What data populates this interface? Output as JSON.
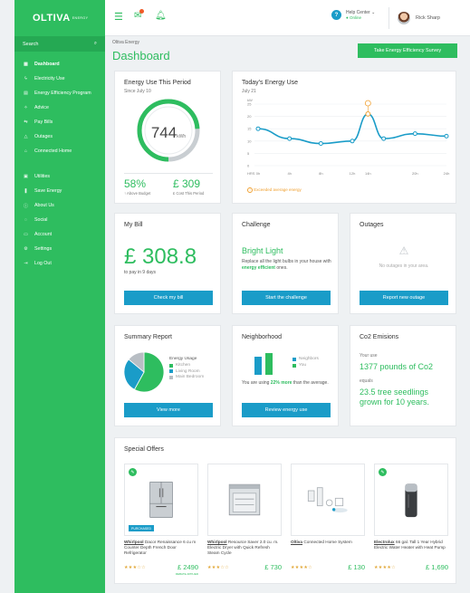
{
  "app": {
    "logo": "OLTIVA",
    "logo_sub": "ENERGY"
  },
  "sidebar": {
    "search_label": "Search",
    "items": [
      {
        "label": "Dashboard",
        "icon": "▦",
        "active": true
      },
      {
        "label": "Electricity Use",
        "icon": "ϟ"
      },
      {
        "label": "Energy Efficiency Program",
        "icon": "▤"
      },
      {
        "label": "Advice",
        "icon": "✧"
      },
      {
        "label": "Pay Bills",
        "icon": "⇆"
      },
      {
        "label": "Outages",
        "icon": "△"
      },
      {
        "label": "Connected Home",
        "icon": "⌂"
      }
    ],
    "items2": [
      {
        "label": "Utilities",
        "icon": "▣"
      },
      {
        "label": "Save Energy",
        "icon": "❚"
      },
      {
        "label": "About Us",
        "icon": "ⓘ"
      },
      {
        "label": "Social",
        "icon": "◌"
      },
      {
        "label": "Account",
        "icon": "▭"
      },
      {
        "label": "Settings",
        "icon": "⚙"
      },
      {
        "label": "Log Out",
        "icon": "⇥"
      }
    ]
  },
  "topbar": {
    "help": "Help Center",
    "status": "● Online",
    "user": "Rick Sharp"
  },
  "page": {
    "breadcrumb": "Oltiva Energy",
    "title": "Dashboard",
    "survey_button": "Take Energy Efficiency Survey"
  },
  "energy_use": {
    "title": "Energy Use This Period",
    "since": "Since July 10",
    "value": "744",
    "unit": "kWh",
    "ring_fraction": 0.74,
    "percent": "58%",
    "percent_label": "↑ Above Budget",
    "cost": "£ 309",
    "cost_label": "£ Cost This Period"
  },
  "today": {
    "title": "Today's Energy Use",
    "date": "July 21",
    "legend": "Exceeded average energy"
  },
  "chart_data": {
    "type": "line",
    "ylabel": "kW",
    "yticks": [
      "25",
      "20",
      "15",
      "10",
      "5",
      "0"
    ],
    "ylim": [
      0,
      25
    ],
    "xticks": [
      "HRS",
      "0h",
      "4h",
      "8h",
      "12h",
      "14h",
      "20h",
      "24h"
    ],
    "x": [
      0,
      4,
      8,
      12,
      14,
      16,
      20,
      24
    ],
    "values": [
      15,
      11,
      9,
      10,
      21,
      11,
      13,
      12
    ],
    "peak_index": 4,
    "color": "#1a9cc8",
    "peak_color": "#f0a030"
  },
  "bill": {
    "title": "My Bill",
    "amount": "£ 308.8",
    "due": "to pay in 9 days",
    "button": "Check my bill"
  },
  "challenge": {
    "title": "Challenge",
    "heading": "Bright Light",
    "text_pre": "Replace all the light bulbs in your house with ",
    "text_em": "energy efficient",
    "text_post": " ones.",
    "button": "Start the challenge"
  },
  "outages": {
    "title": "Outages",
    "message": "No outages in your area.",
    "button": "Report new outage"
  },
  "summary": {
    "title": "Summary Report",
    "legend_title": "Energy Usage",
    "items": [
      {
        "label": "Kitchen",
        "color": "#2ebd5f",
        "value": 0.58
      },
      {
        "label": "Living Room",
        "color": "#1a9cc8",
        "value": 0.28
      },
      {
        "label": "Main Bedroom",
        "color": "#b8bec4",
        "value": 0.14
      }
    ],
    "button": "View more"
  },
  "neighborhood": {
    "title": "Neighborhood",
    "legend": [
      "Neighbors",
      "You"
    ],
    "colors": [
      "#1a9cc8",
      "#2ebd5f"
    ],
    "neighbors_value": 0.82,
    "you_value": 1,
    "text_pre": "You are using ",
    "text_em": "22% more",
    "text_post": " than the average.",
    "button": "Review energy use"
  },
  "co2": {
    "title": "Co2 Emisions",
    "use_label": "Your use",
    "use_value": "1377 pounds of Co2",
    "equals": "equals",
    "equals_value": "23.5 tree seedlings grown for 10 years."
  },
  "offers": {
    "title": "Special Offers",
    "items": [
      {
        "brand": "Whirlpool",
        "name": " Dacor Renaissance 6 cu m Counter Depth French Door Refrigerator",
        "stars": "★★★☆☆",
        "price": "£ 2490",
        "note": "REBATE APPLIED",
        "tag": true,
        "purchased": "PURCHASED"
      },
      {
        "brand": "Whirlpool",
        "name": " Resource Saver 2.0 cu. m. Electric Dryer with Quick Refresh Steam Cycle",
        "stars": "★★★☆☆",
        "price": "£ 730"
      },
      {
        "brand": "Oltiva",
        "name": " Connected Home System",
        "stars": "★★★★☆",
        "price": "£ 130"
      },
      {
        "brand": "Electrolux",
        "name": " 66 gal. Tall 1 Year Hybrid Electric Water Heater with Heat Pump",
        "stars": "★★★★☆",
        "price": "£ 1,690",
        "tag": true
      }
    ]
  }
}
